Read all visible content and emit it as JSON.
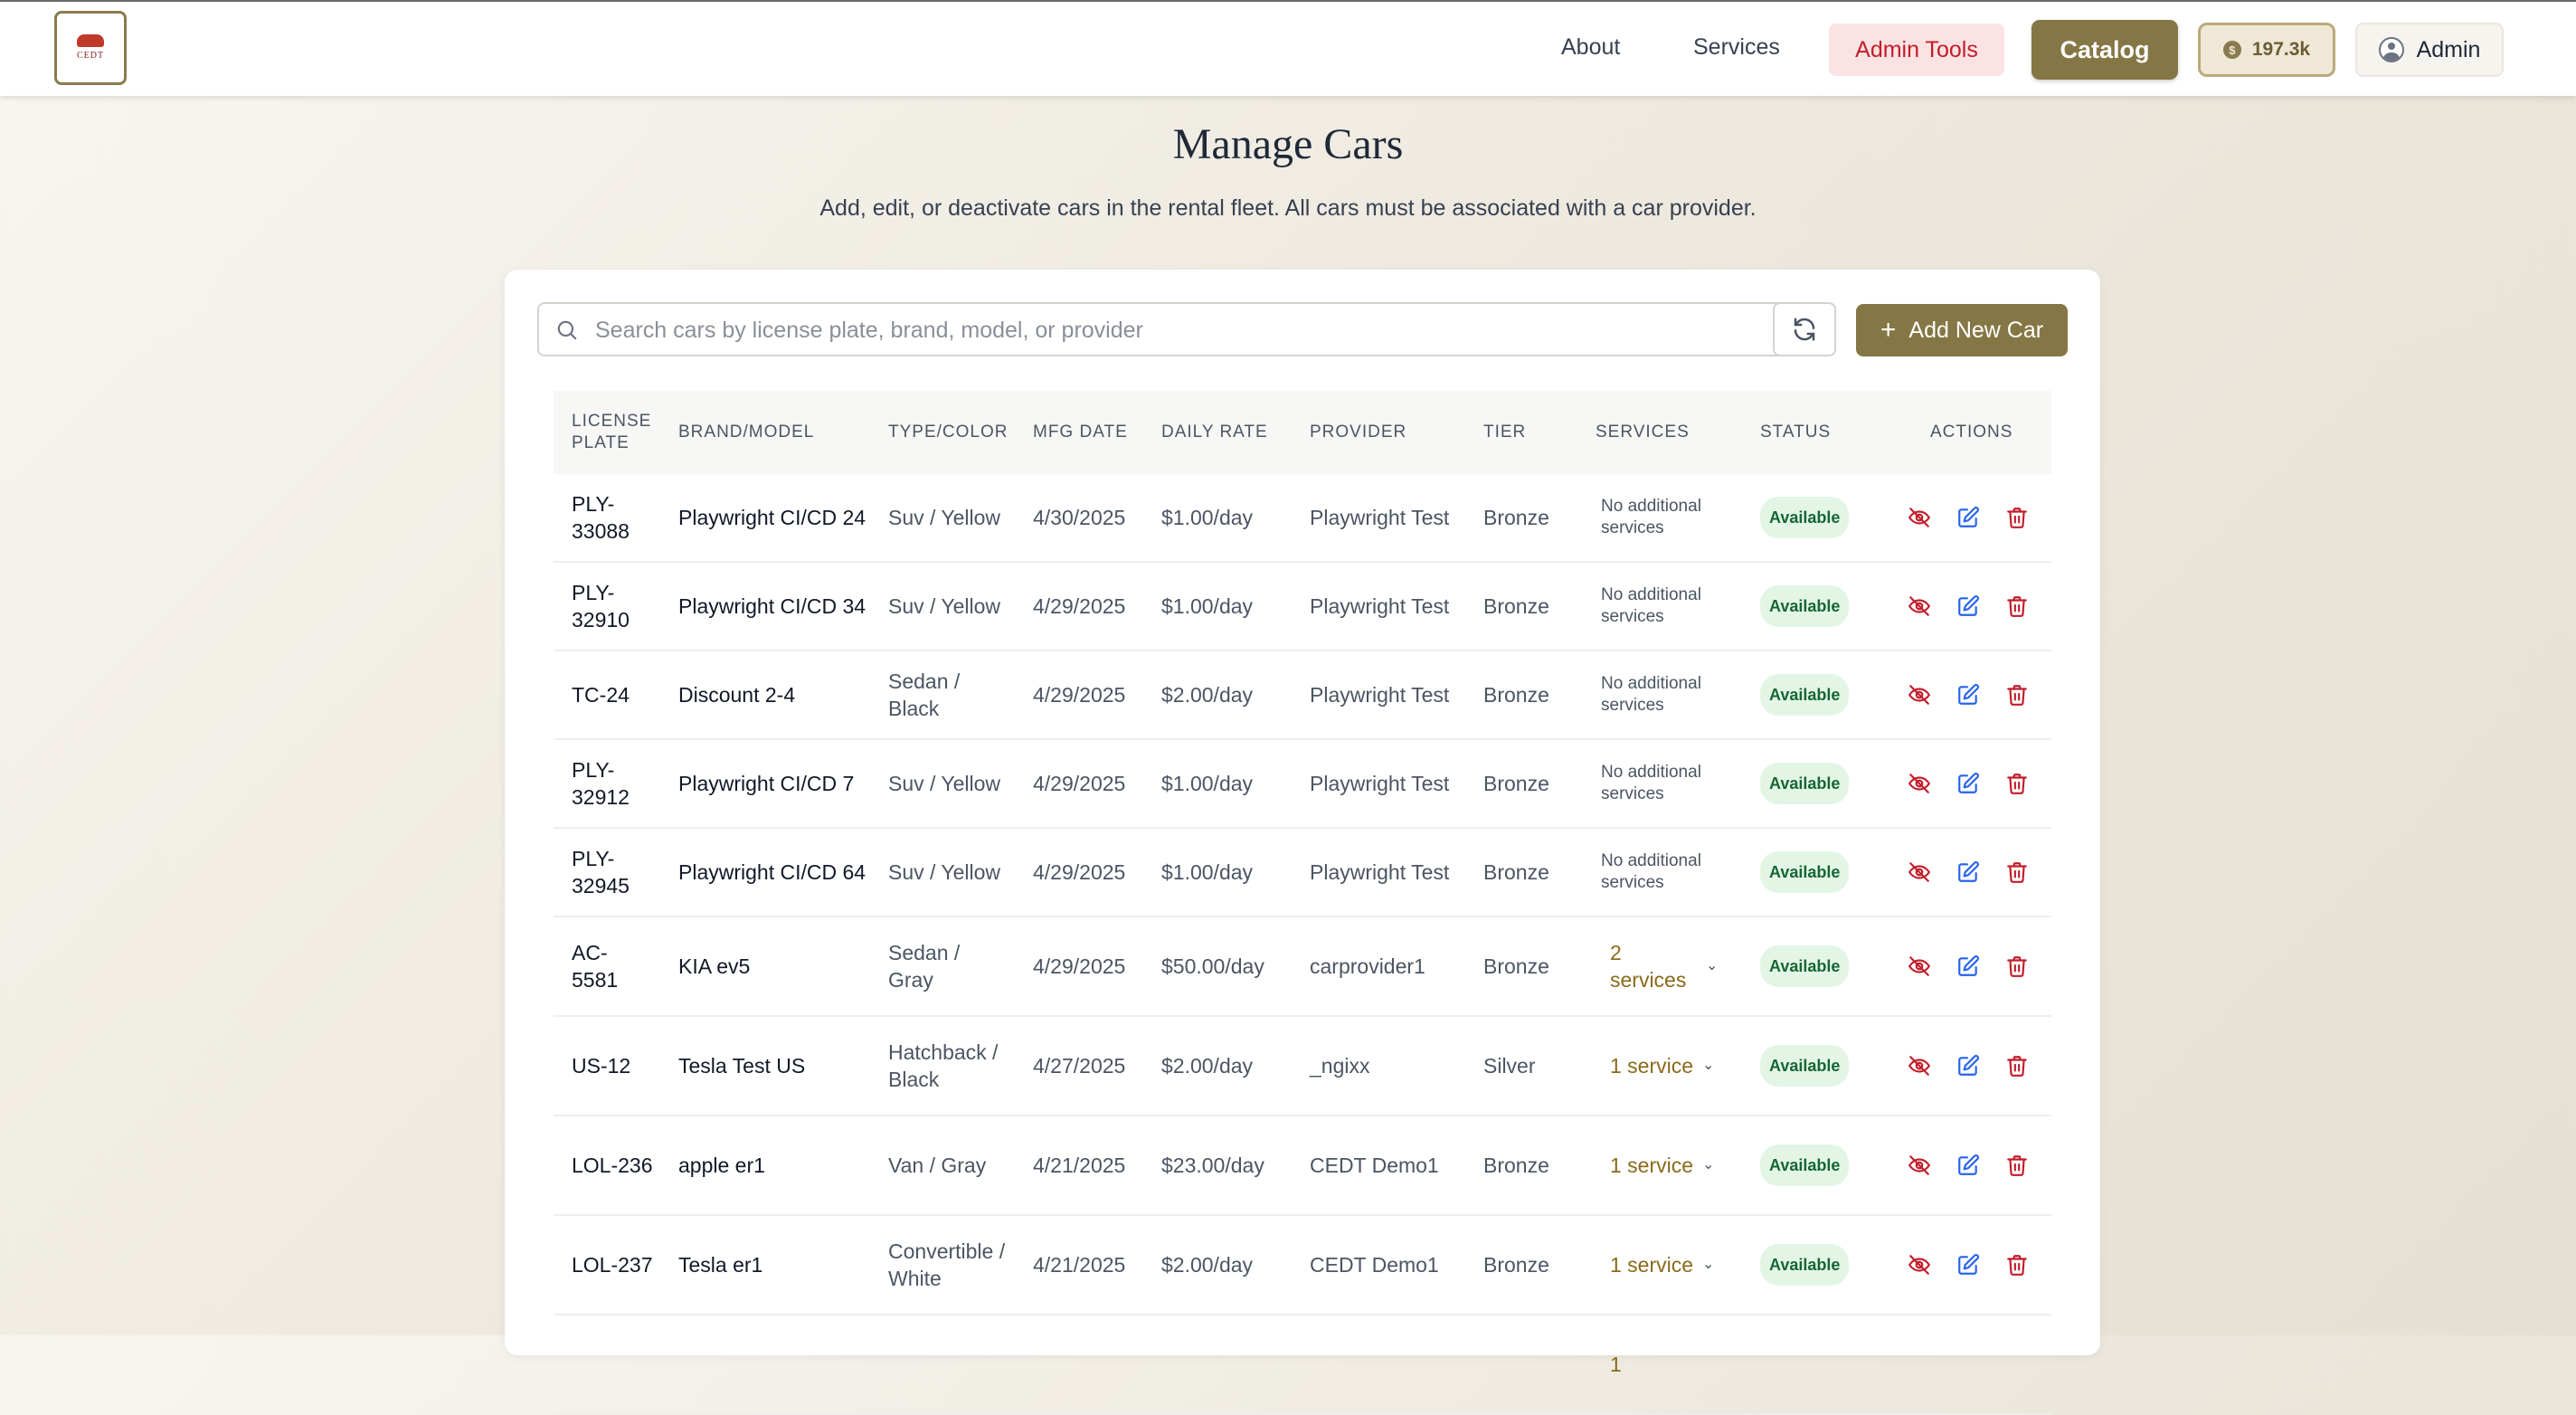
{
  "header": {
    "logo_text": "CEDT",
    "nav": [
      "About",
      "Services"
    ],
    "admin_tools": "Admin Tools",
    "catalog": "Catalog",
    "coins": "197.3k",
    "user": "Admin"
  },
  "page": {
    "title": "Manage Cars",
    "subtitle": "Add, edit, or deactivate cars in the rental fleet. All cars must be associated with a car provider."
  },
  "toolbar": {
    "search_placeholder": "Search cars by license plate, brand, model, or provider",
    "add_label": "Add New Car"
  },
  "table": {
    "columns": [
      "LICENSE PLATE",
      "BRAND/MODEL",
      "TYPE/COLOR",
      "MFG DATE",
      "DAILY RATE",
      "PROVIDER",
      "TIER",
      "SERVICES",
      "STATUS",
      "ACTIONS"
    ],
    "rows": [
      {
        "plate": "PLY-33088",
        "brand": "Playwright CI/CD 24",
        "type": "Suv / Yellow",
        "mfg": "4/30/2025",
        "rate": "$1.00/day",
        "provider": "Playwright Test",
        "tier": "Bronze",
        "services": "No additional services",
        "status": "Available"
      },
      {
        "plate": "PLY-32910",
        "brand": "Playwright CI/CD 34",
        "type": "Suv / Yellow",
        "mfg": "4/29/2025",
        "rate": "$1.00/day",
        "provider": "Playwright Test",
        "tier": "Bronze",
        "services": "No additional services",
        "status": "Available"
      },
      {
        "plate": "TC-24",
        "brand": "Discount 2-4",
        "type": "Sedan / Black",
        "mfg": "4/29/2025",
        "rate": "$2.00/day",
        "provider": "Playwright Test",
        "tier": "Bronze",
        "services": "No additional services",
        "status": "Available"
      },
      {
        "plate": "PLY-32912",
        "brand": "Playwright CI/CD 7",
        "type": "Suv / Yellow",
        "mfg": "4/29/2025",
        "rate": "$1.00/day",
        "provider": "Playwright Test",
        "tier": "Bronze",
        "services": "No additional services",
        "status": "Available"
      },
      {
        "plate": "PLY-32945",
        "brand": "Playwright CI/CD 64",
        "type": "Suv / Yellow",
        "mfg": "4/29/2025",
        "rate": "$1.00/day",
        "provider": "Playwright Test",
        "tier": "Bronze",
        "services": "No additional services",
        "status": "Available"
      },
      {
        "plate": "AC-5581",
        "brand": "KIA ev5",
        "type": "Sedan / Gray",
        "mfg": "4/29/2025",
        "rate": "$50.00/day",
        "provider": "carprovider1",
        "tier": "Bronze",
        "services": "2 services",
        "status": "Available"
      },
      {
        "plate": "US-12",
        "brand": "Tesla Test US",
        "type": "Hatchback / Black",
        "mfg": "4/27/2025",
        "rate": "$2.00/day",
        "provider": "_ngixx",
        "tier": "Silver",
        "services": "1 service",
        "status": "Available"
      },
      {
        "plate": "LOL-236",
        "brand": "apple er1",
        "type": "Van / Gray",
        "mfg": "4/21/2025",
        "rate": "$23.00/day",
        "provider": "CEDT Demo1",
        "tier": "Bronze",
        "services": "1 service",
        "status": "Available"
      },
      {
        "plate": "LOL-237",
        "brand": "Tesla er1",
        "type": "Convertible / White",
        "mfg": "4/21/2025",
        "rate": "$2.00/day",
        "provider": "CEDT Demo1",
        "tier": "Bronze",
        "services": "1 service",
        "status": "Available"
      },
      {
        "plate": "",
        "brand": "",
        "type": "",
        "mfg": "",
        "rate": "",
        "provider": "",
        "tier": "",
        "services": "1",
        "status": ""
      }
    ]
  },
  "colors": {
    "accent": "#857645",
    "danger": "#c21d2a",
    "edit": "#2563eb",
    "success_bg": "#e3f6e6",
    "success_text": "#166534"
  },
  "icons": {
    "hide": "eye-off-icon",
    "edit": "edit-icon",
    "delete": "trash-icon",
    "search": "search-icon",
    "refresh": "refresh-icon",
    "add": "plus-icon"
  }
}
